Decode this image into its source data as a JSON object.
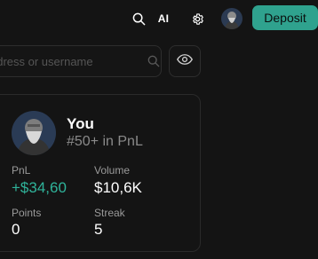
{
  "header": {
    "ai_label": "AI",
    "deposit_label": "Deposit",
    "icons": [
      "search-icon",
      "settings-gear-icon"
    ]
  },
  "search": {
    "placeholder": "ddress or username",
    "icons": [
      "search-icon",
      "eye-icon"
    ]
  },
  "profile": {
    "name": "You",
    "rank": "#50+ in PnL",
    "stats": {
      "pnl_label": "PnL",
      "pnl_value": "+$34,60",
      "volume_label": "Volume",
      "volume_value": "$10,6K",
      "points_label": "Points",
      "points_value": "0",
      "streak_label": "Streak",
      "streak_value": "5"
    }
  },
  "colors": {
    "accent": "#2fa28e",
    "positive": "#2fb39a",
    "background": "#141414",
    "border": "#2e2e2e",
    "muted_text": "#8a8a8a"
  }
}
